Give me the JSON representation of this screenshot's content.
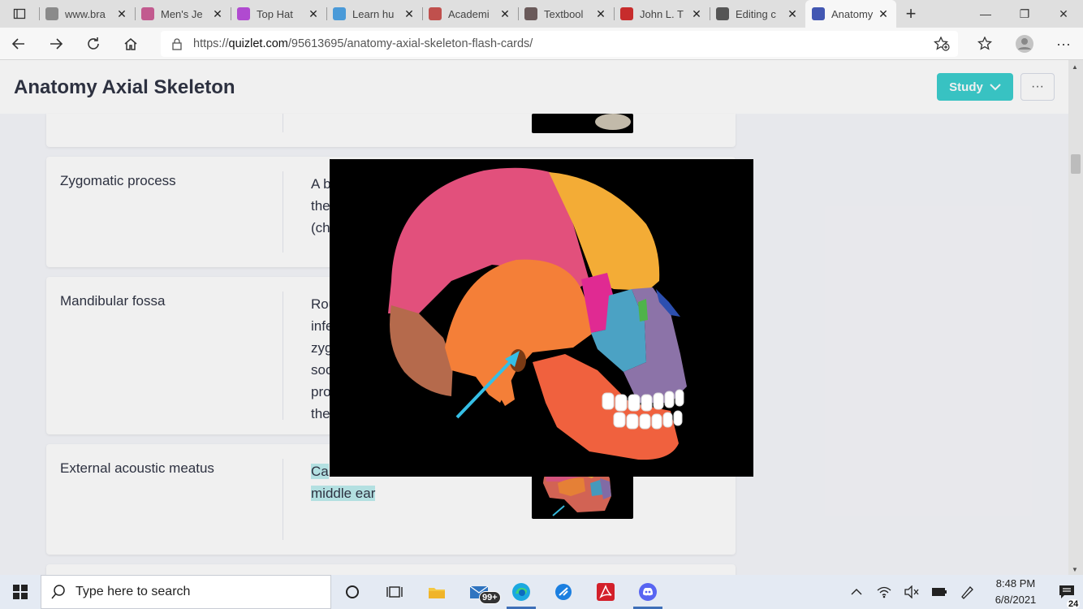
{
  "browser": {
    "tabs": [
      {
        "title": "www.bra",
        "icon": "globe-icon",
        "color": "#8a8a8a"
      },
      {
        "title": "Men's Je",
        "icon": "bookmark-icon",
        "color": "#c25a8f"
      },
      {
        "title": "Top Hat",
        "icon": "tophat-icon",
        "color": "#b04ad0"
      },
      {
        "title": "Learn hu",
        "icon": "k-icon",
        "color": "#4a9ad8"
      },
      {
        "title": "Academi",
        "icon": "my-icon",
        "color": "#c0504d"
      },
      {
        "title": "Textbool",
        "icon": "textbook-icon",
        "color": "#6a5a5a"
      },
      {
        "title": "John L. T",
        "icon": "pdf-icon",
        "color": "#c72c2c"
      },
      {
        "title": "Editing c",
        "icon": "editing-icon",
        "color": "#555"
      },
      {
        "title": "Anatomy",
        "icon": "quizlet-icon",
        "color": "#4257b2"
      }
    ],
    "url_prefix": "https://",
    "url_domain": "quizlet.com",
    "url_path": "/95613695/anatomy-axial-skeleton-flash-cards/"
  },
  "page": {
    "title": "Anatomy Axial Skeleton",
    "study_label": "Study",
    "more_label": "···"
  },
  "cards": [
    {
      "term": "Zygomatic process",
      "def_lines": [
        "A b",
        "the",
        "(ch"
      ]
    },
    {
      "term": "Mandibular fossa",
      "def_lines": [
        "Rou",
        "infe",
        "zyg",
        "soc",
        "pro",
        "the"
      ]
    },
    {
      "term": "External acoustic meatus",
      "def_lines": [
        "Ca",
        "middle ear"
      ]
    }
  ],
  "taskbar": {
    "search_placeholder": "Type here to search",
    "mail_badge": "99+",
    "time": "8:48 PM",
    "date": "6/8/2021",
    "notification_count": "24"
  }
}
